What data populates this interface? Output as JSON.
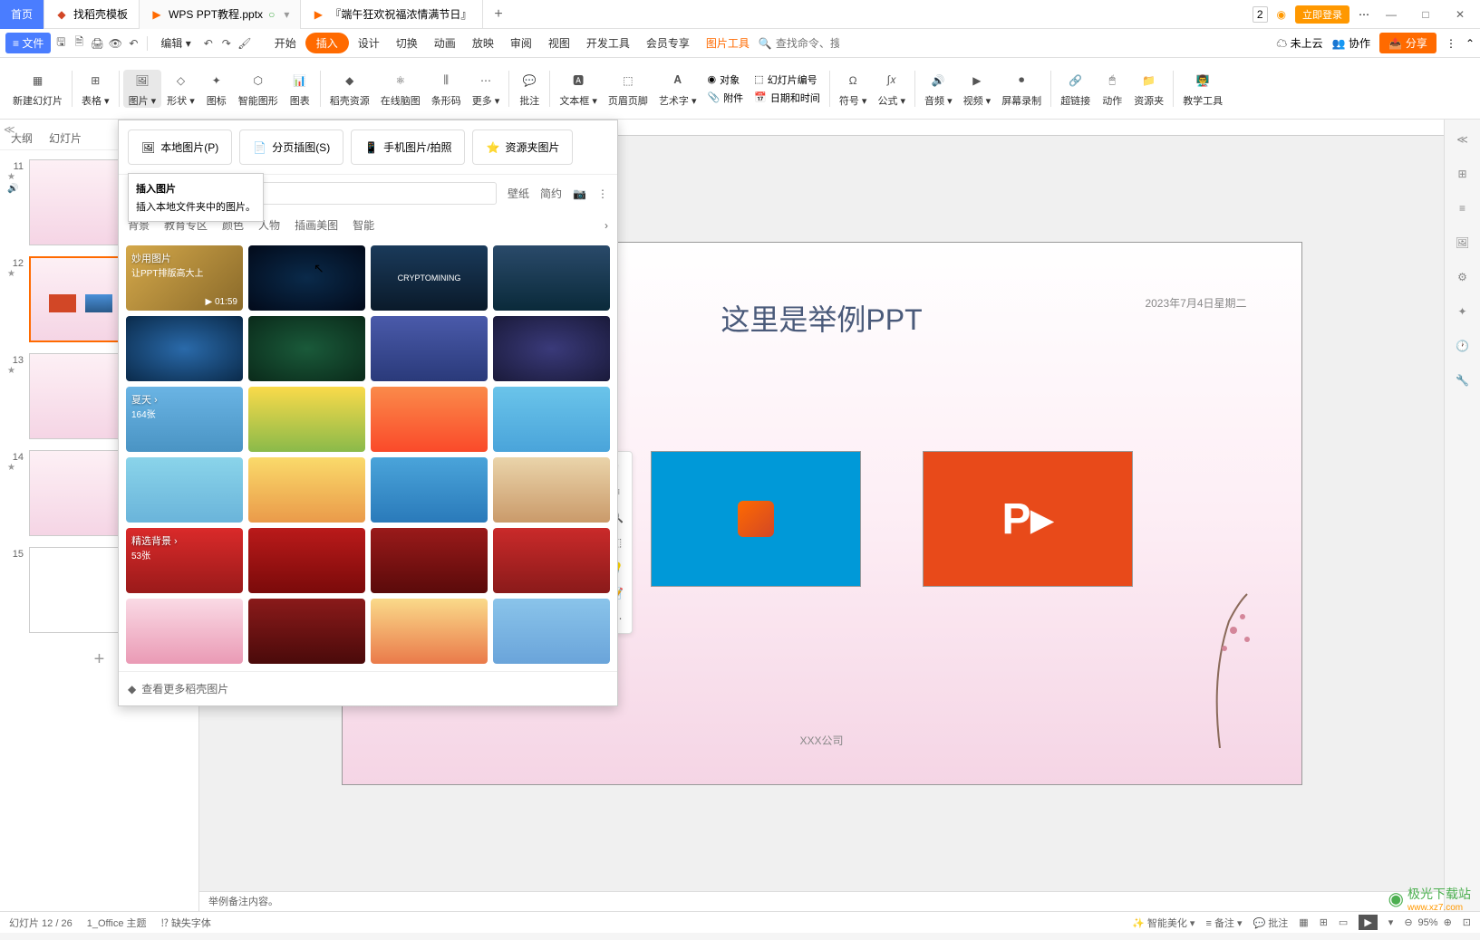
{
  "titlebar": {
    "home": "首页",
    "tabs": [
      {
        "label": "找稻壳模板",
        "icon": "d"
      },
      {
        "label": "WPS PPT教程.pptx",
        "icon": "p",
        "active": true
      },
      {
        "label": "『端午狂欢祝福浓情满节日』",
        "icon": "p"
      }
    ],
    "login": "立即登录",
    "badge": "2"
  },
  "menubar": {
    "file": "文件",
    "edit": "编辑",
    "tabs": [
      "开始",
      "插入",
      "设计",
      "切换",
      "动画",
      "放映",
      "审阅",
      "视图",
      "开发工具",
      "会员专享"
    ],
    "active_tab": "插入",
    "pic_tools": "图片工具",
    "search_placeholder": "查找命令、搜索模板",
    "cloud": "未上云",
    "collab": "协作",
    "share": "分享"
  },
  "ribbon": {
    "items": [
      {
        "label": "新建幻灯片"
      },
      {
        "label": "表格"
      },
      {
        "label": "图片",
        "active": true
      },
      {
        "label": "形状"
      },
      {
        "label": "图标"
      },
      {
        "label": "智能图形"
      },
      {
        "label": "图表"
      },
      {
        "label": "稻壳资源"
      },
      {
        "label": "在线脑图"
      },
      {
        "label": "条形码"
      },
      {
        "label": "更多"
      },
      {
        "label": "批注"
      },
      {
        "label": "文本框"
      },
      {
        "label": "页眉页脚"
      },
      {
        "label": "艺术字"
      },
      {
        "label": "符号"
      },
      {
        "label": "公式"
      },
      {
        "label": "音频"
      },
      {
        "label": "视频"
      },
      {
        "label": "屏幕录制"
      },
      {
        "label": "超链接"
      },
      {
        "label": "动作"
      },
      {
        "label": "资源夹"
      },
      {
        "label": "教学工具"
      }
    ],
    "small": {
      "object": "对象",
      "attachment": "附件",
      "slide_num": "幻灯片编号",
      "datetime": "日期和时间"
    }
  },
  "slide_panel": {
    "tabs": [
      "大纲",
      "幻灯片"
    ],
    "slides": [
      {
        "num": "11"
      },
      {
        "num": "12",
        "selected": true
      },
      {
        "num": "13"
      },
      {
        "num": "14"
      },
      {
        "num": "15"
      }
    ]
  },
  "dropdown": {
    "sources": [
      {
        "label": "本地图片(P)"
      },
      {
        "label": "分页插图(S)"
      },
      {
        "label": "手机图片/拍照"
      },
      {
        "label": "资源夹图片"
      }
    ],
    "tooltip_title": "插入图片",
    "tooltip_body": "插入本地文件夹中的图片。",
    "filters": [
      "壁纸",
      "简约"
    ],
    "categories": [
      "背景",
      "教育专区",
      "颜色",
      "人物",
      "插画美图",
      "智能"
    ],
    "promo": {
      "line1": "妙用图片",
      "line2": "让PPT排版高大上",
      "time": "01:59"
    },
    "summer": {
      "label": "夏天",
      "count": "164张"
    },
    "featured": {
      "label": "精选背景",
      "count": "53张"
    },
    "more": "查看更多稻壳图片",
    "crypto": "CRYPTOMINING"
  },
  "slide": {
    "title": "这里是举例PPT",
    "date": "2023年7月4日星期二",
    "company": "XXX公司"
  },
  "notes": "举例备注内容。",
  "statusbar": {
    "slide_info": "幻灯片 12 / 26",
    "theme": "1_Office 主题",
    "missing_font": "缺失字体",
    "beautify": "智能美化",
    "notes_btn": "备注",
    "comments_btn": "批注",
    "zoom": "95%"
  },
  "watermark": {
    "name": "极光下载站",
    "url": "www.xz7.com"
  }
}
